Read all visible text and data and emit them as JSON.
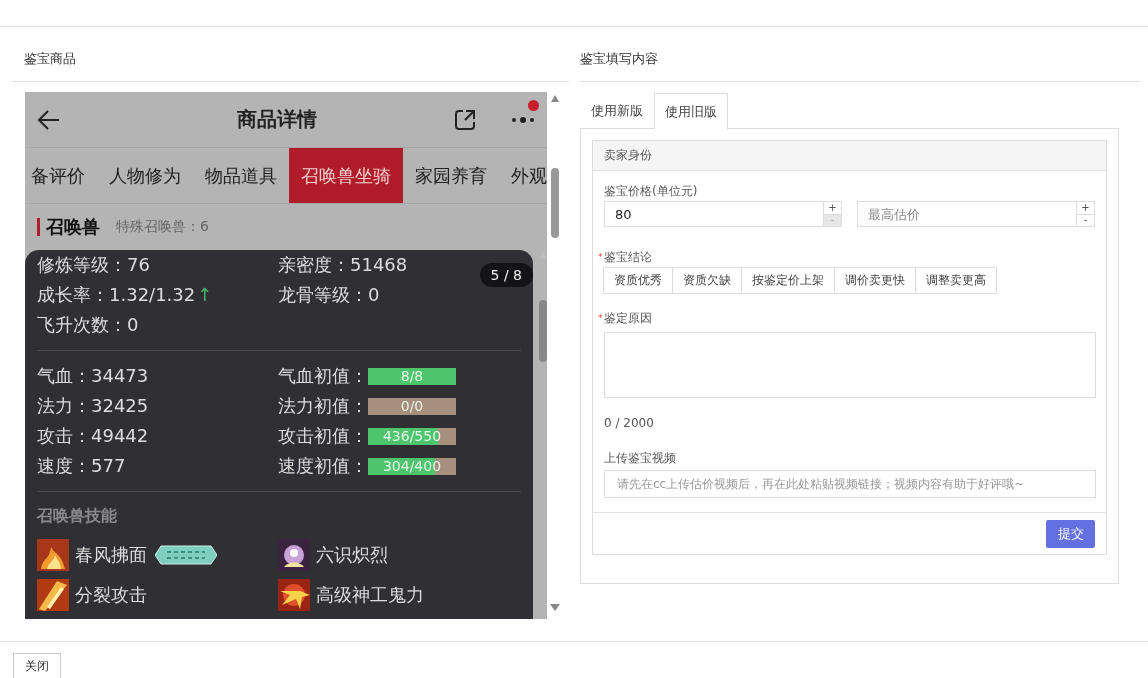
{
  "left_panel": {
    "title": "鉴宝商品",
    "phone": {
      "title": "商品详情",
      "notification": true,
      "tabs": [
        {
          "label": "备评价",
          "selected": false
        },
        {
          "label": "人物修为",
          "selected": false
        },
        {
          "label": "物品道具",
          "selected": false
        },
        {
          "label": "召唤兽坐骑",
          "selected": true
        },
        {
          "label": "家园养育",
          "selected": false
        },
        {
          "label": "外观",
          "selected": false
        }
      ],
      "section": {
        "title": "召唤兽",
        "subtitle": "特殊召唤兽：6"
      },
      "detail": {
        "page": "5 / 8",
        "attributes": [
          {
            "text": "修炼等级：76"
          },
          {
            "text": "亲密度：51468"
          },
          {
            "text": "成长率：1.32/1.32",
            "arrow": "↑"
          },
          {
            "text": "龙骨等级：0"
          },
          {
            "text": "飞升次数：0"
          }
        ],
        "stats": [
          {
            "stat": "气血：34473",
            "aptitude": {
              "label": "气血初值：",
              "value": "8/8",
              "level": 1
            }
          },
          {
            "stat": "法力：32425",
            "aptitude": {
              "label": "法力初值：",
              "value": "0/0",
              "level": 0
            }
          },
          {
            "stat": "攻击：49442",
            "aptitude": {
              "label": "攻击初值：",
              "value": "436/550",
              "level": 0.79
            }
          },
          {
            "stat": "速度：577",
            "aptitude": {
              "label": "速度初值：",
              "value": "304/400",
              "level": 0.76
            }
          }
        ],
        "skills_title": "召唤兽技能",
        "skills": [
          {
            "name": "春风拂面",
            "kind": "fire",
            "talent": true
          },
          {
            "name": "六识炽烈",
            "kind": "aura",
            "talent": false
          },
          {
            "name": "分裂攻击",
            "kind": "slash",
            "talent": false
          },
          {
            "name": "高级神工鬼力",
            "kind": "burst",
            "talent": false
          }
        ]
      }
    }
  },
  "right_panel": {
    "title": "鉴宝填写内容",
    "tabs": [
      {
        "label": "使用新版",
        "selected": false
      },
      {
        "label": "使用旧版",
        "selected": true
      }
    ],
    "section_title": "卖家身份",
    "price": {
      "label": "鉴宝价格(单位元)",
      "value": "80",
      "max_placeholder": "最高估价",
      "plus": "+",
      "minus": "-",
      "value_minus_disabled": true,
      "max_minus_disabled": false
    },
    "conclusion": {
      "label": "鉴宝结论",
      "required_mark": "*",
      "options": [
        {
          "label": "资质优秀",
          "selected": false
        },
        {
          "label": "资质欠缺",
          "selected": false
        },
        {
          "label": "按鉴定价上架",
          "selected": false
        },
        {
          "label": "调价卖更快",
          "selected": false
        },
        {
          "label": "调整卖更高",
          "selected": false
        }
      ]
    },
    "reason": {
      "label": "鉴定原因",
      "required_mark": "*",
      "counter": "0 / 2000"
    },
    "video": {
      "label": "上传鉴宝视频",
      "placeholder": "请先在cc上传估价视频后，再在此处粘贴视频链接；视频内容有助于好评哦~"
    },
    "submit": "提交"
  },
  "footer": {
    "close": "关闭"
  }
}
